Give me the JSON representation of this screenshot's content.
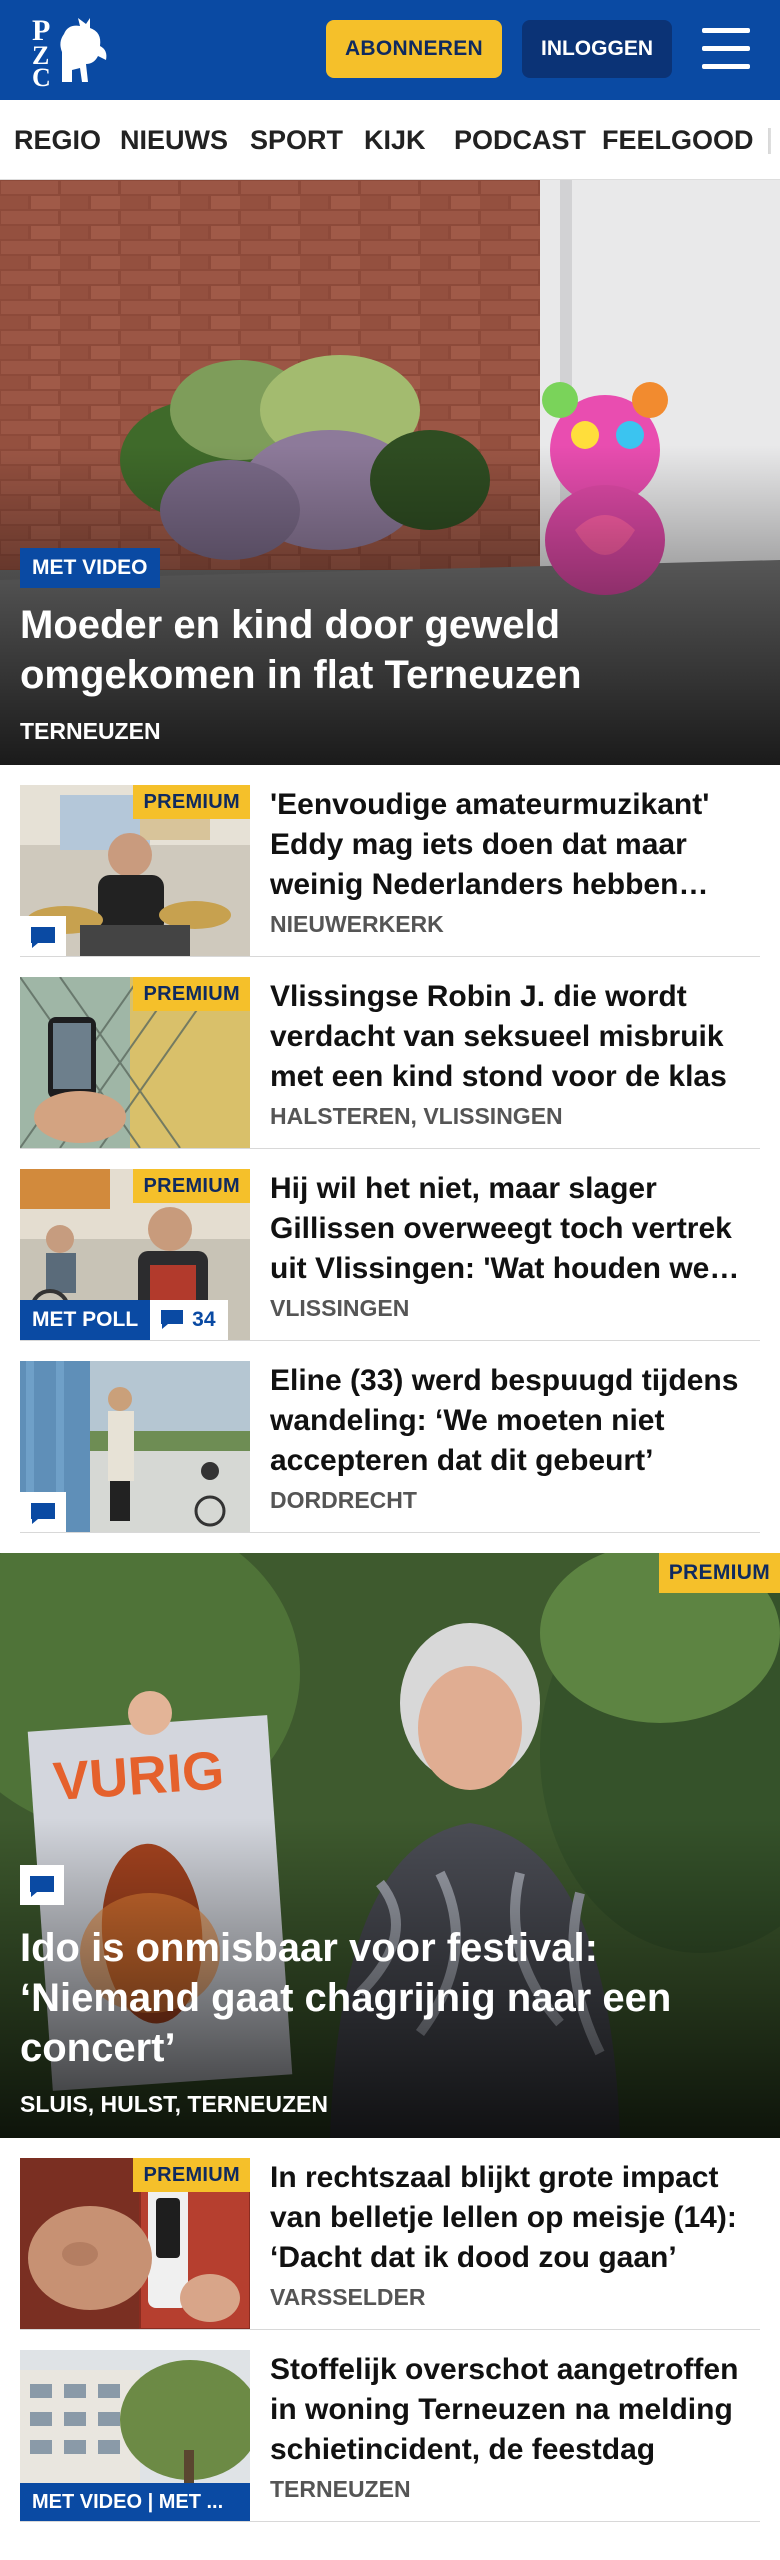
{
  "header": {
    "logo_letters": [
      "P",
      "Z",
      "C"
    ],
    "subscribe_label": "ABONNEREN",
    "login_label": "INLOGGEN"
  },
  "nav": {
    "items": [
      "REGIO",
      "NIEUWS",
      "SPORT",
      "KIJK",
      "PODCAST",
      "FEELGOOD"
    ]
  },
  "hero": {
    "badge": "MET VIDEO",
    "title": "Moeder en kind door geweld omgekomen in flat Terneuzen",
    "location": "TERNEUZEN"
  },
  "articles": [
    {
      "premium": "PREMIUM",
      "title": "'Eenvoudige amateurmuzikant' Eddy mag iets doen dat maar weinig Nederlanders hebben gedaan",
      "location": "NIEUWERKERK"
    },
    {
      "premium": "PREMIUM",
      "title": "Vlissingse Robin J. die wordt verdacht van seksueel misbruik met een kind stond voor de klas",
      "location": "HALSTEREN, VLISSINGEN"
    },
    {
      "premium": "PREMIUM",
      "title": "Hij wil het niet, maar slager Gillissen overweegt toch vertrek uit Vlissingen: 'Wat houden we over'",
      "location": "VLISSINGEN",
      "poll_label": "MET POLL",
      "comment_count": "34"
    },
    {
      "title": "Eline (33) werd bespuugd tijdens wandeling: ‘We moeten niet accepteren dat dit gebeurt’",
      "location": "DORDRECHT"
    }
  ],
  "feature": {
    "premium": "PREMIUM",
    "poster_text": "VURIG",
    "title": "Ido is onmisbaar voor festival: ‘Niemand gaat chagrijnig naar een concert’",
    "location": "SLUIS, HULST, TERNEUZEN"
  },
  "articles_bottom": [
    {
      "premium": "PREMIUM",
      "title": "In rechtszaal blijkt grote impact van belletje lellen op meisje (14): ‘Dacht dat ik dood zou gaan’",
      "location": "VARSSELDER"
    },
    {
      "badge": "MET VIDEO | MET ...",
      "title": "Stoffelijk overschot aangetrof­fen in woning Terneuzen na melding schietincident, de feestdag",
      "location": "TERNEUZEN"
    }
  ],
  "colors": {
    "brand_blue": "#0a4aa3",
    "premium_yellow": "#f5c02a",
    "dark_navy": "#0b3376"
  }
}
